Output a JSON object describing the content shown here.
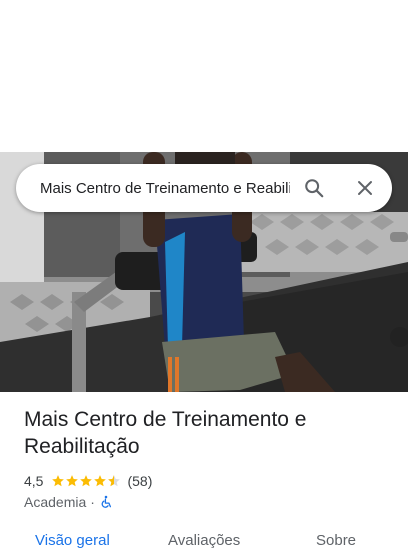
{
  "search": {
    "query": "Mais Centro de Treinamento e Reabilitação",
    "search_icon": "search-icon",
    "close_icon": "close-icon"
  },
  "place": {
    "name": "Mais Centro de Treinamento e Reabilitação",
    "rating": "4,5",
    "rating_value": 4.5,
    "review_count": "(58)",
    "category": "Academia",
    "separator": "·",
    "accessibility_icon": "wheelchair-icon"
  },
  "tabs": [
    {
      "label": "Visão geral",
      "active": true
    },
    {
      "label": "Avaliações",
      "active": false
    },
    {
      "label": "Sobre",
      "active": false
    }
  ],
  "colors": {
    "accent": "#1a73e8",
    "star": "#fbbc04",
    "star_empty": "#dadce0"
  }
}
